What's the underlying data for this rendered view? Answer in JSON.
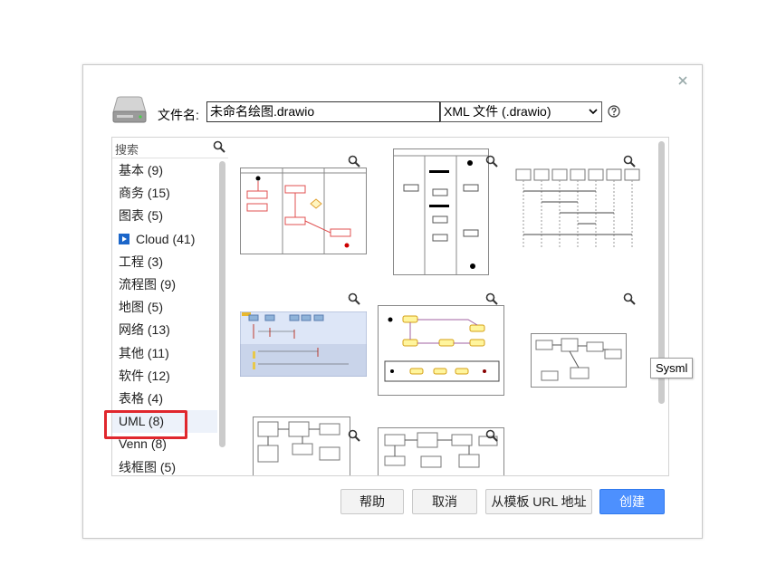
{
  "dialog": {
    "filename_label": "文件名:",
    "filename_value": "未命名绘图.drawio",
    "filetype_selected": "XML 文件 (.drawio)",
    "icons": [
      "close-icon",
      "drive-icon",
      "help-icon",
      "search-icon",
      "zoom-icon"
    ]
  },
  "sidebar": {
    "search_placeholder": "搜索",
    "categories": [
      {
        "label": "基本 (9)"
      },
      {
        "label": "商务 (15)"
      },
      {
        "label": "图表 (5)"
      },
      {
        "label": "Cloud (41)"
      },
      {
        "label": "工程 (3)"
      },
      {
        "label": "流程图 (9)"
      },
      {
        "label": "地图 (5)"
      },
      {
        "label": "网络 (13)"
      },
      {
        "label": "其他 (11)"
      },
      {
        "label": "软件 (12)"
      },
      {
        "label": "表格 (4)"
      },
      {
        "label": "UML (8)"
      },
      {
        "label": "Venn (8)"
      },
      {
        "label": "线框图 (5)"
      }
    ],
    "selected": "UML (8)"
  },
  "tooltip": "Sysml",
  "buttons": {
    "help": "帮助",
    "cancel": "取消",
    "from_url": "从模板 URL 地址",
    "create": "创建"
  },
  "colors": {
    "primary": "#4d90fe",
    "highlight": "#e0272d",
    "selected_bg": "#edf2fa"
  }
}
